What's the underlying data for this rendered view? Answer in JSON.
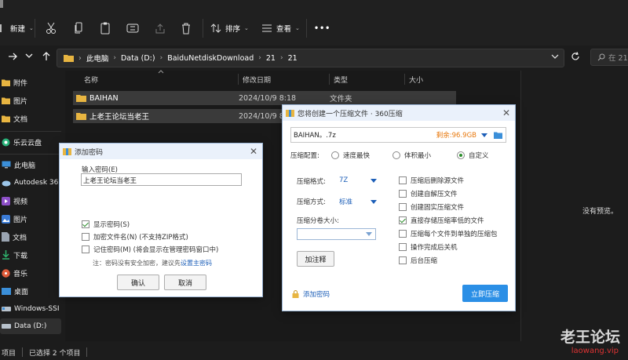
{
  "toolbar": {
    "new_label": "新建",
    "sort_label": "排序",
    "view_label": "查看",
    "more_label": "•••"
  },
  "address": {
    "crumbs": [
      "此电脑",
      "Data (D:)",
      "BaiduNetdiskDownload",
      "21",
      "21"
    ],
    "search_placeholder": "在 21"
  },
  "sidebar": {
    "items": [
      {
        "label": "附件",
        "icon": "folder-icon"
      },
      {
        "label": "图片",
        "icon": "folder-icon"
      },
      {
        "label": "文档",
        "icon": "folder-icon"
      },
      {
        "label": "乐云云盘",
        "icon": "cloud-icon"
      },
      {
        "label": "此电脑",
        "icon": "pc-icon"
      },
      {
        "label": "Autodesk 36",
        "icon": "cloud-drive-icon"
      },
      {
        "label": "视频",
        "icon": "video-icon"
      },
      {
        "label": "图片",
        "icon": "picture-icon"
      },
      {
        "label": "文档",
        "icon": "document-icon"
      },
      {
        "label": "下载",
        "icon": "download-icon"
      },
      {
        "label": "音乐",
        "icon": "music-icon"
      },
      {
        "label": "桌面",
        "icon": "desktop-icon"
      },
      {
        "label": "Windows-SSI",
        "icon": "drive-icon"
      },
      {
        "label": "Data (D:)",
        "icon": "drive-icon"
      }
    ]
  },
  "file_list": {
    "columns": [
      "名称",
      "修改日期",
      "类型",
      "大小"
    ],
    "rows": [
      {
        "name": "BAIHAN",
        "date": "2024/10/9 8:18",
        "type": "文件夹",
        "size": ""
      },
      {
        "name": "上老王论坛当老王",
        "date": "2024/10/9 8:1",
        "type": "",
        "size": ""
      }
    ]
  },
  "preview": {
    "text": "没有预览。"
  },
  "status": {
    "items": "项目",
    "selected": "已选择 2 个项目"
  },
  "password_dialog": {
    "title": "添加密码",
    "input_label": "输入密码(E)",
    "input_value": "上老王论坛当老王",
    "show_password": "显示密码(S)",
    "encrypt_names": "加密文件名(N) (不支持ZIP格式)",
    "remember": "记住密码(M) (将会显示在管理密码窗口中)",
    "note_prefix": "注：密码没有安全加密，建议先",
    "note_link": "设置主密码",
    "ok": "确认",
    "cancel": "取消"
  },
  "compress_dialog": {
    "title": "您将创建一个压缩文件 · 360压缩",
    "filename": "BAIHAN。.7z",
    "free_space": "剩余:96.9GB",
    "config_label": "压缩配置:",
    "config_options": [
      "速度最快",
      "体积最小",
      "自定义"
    ],
    "format_label": "压缩格式:",
    "format_value": "7Z",
    "method_label": "压缩方式:",
    "method_value": "标准",
    "split_label": "压缩分卷大小:",
    "comment_button": "加注释",
    "options": [
      {
        "label": "压缩后删除源文件",
        "checked": false
      },
      {
        "label": "创建自解压文件",
        "checked": false
      },
      {
        "label": "创建固实压缩文件",
        "checked": false
      },
      {
        "label": "直接存储压缩率低的文件",
        "checked": true
      },
      {
        "label": "压缩每个文件到单独的压缩包",
        "checked": false
      },
      {
        "label": "操作完成后关机",
        "checked": false
      },
      {
        "label": "后台压缩",
        "checked": false
      }
    ],
    "add_password": "添加密码",
    "start_button": "立即压缩"
  },
  "watermark": {
    "cn": "老王论坛",
    "url": "laowang.vip"
  },
  "colors": {
    "accent": "#2b8fe6",
    "free_space": "#e8780c",
    "folder": "#e8b541",
    "link": "#1d5fb8"
  }
}
